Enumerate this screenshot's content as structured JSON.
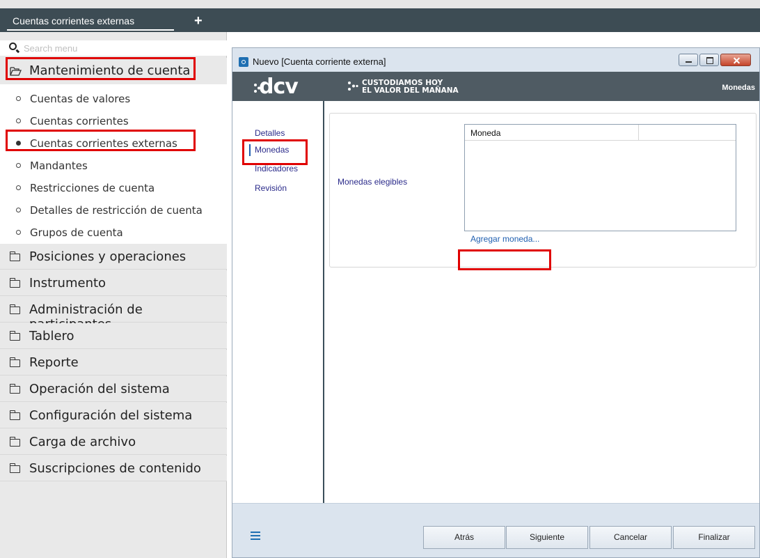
{
  "tabbar": {
    "active_tab": "Cuentas corrientes externas",
    "add_icon": "plus-icon"
  },
  "sidebar": {
    "search_placeholder": "Search menu",
    "open_section": "Mantenimiento de cuenta",
    "items": [
      {
        "label": "Cuentas de valores"
      },
      {
        "label": "Cuentas corrientes"
      },
      {
        "label": "Cuentas corrientes externas"
      },
      {
        "label": "Mandantes"
      },
      {
        "label": "Restricciones de cuenta"
      },
      {
        "label": "Detalles de restricción de cuenta"
      },
      {
        "label": "Grupos de cuenta"
      }
    ],
    "sections": [
      {
        "label": "Posiciones y operaciones"
      },
      {
        "label": "Instrumento"
      },
      {
        "label": "Administración de participantes"
      },
      {
        "label": "Tablero"
      },
      {
        "label": "Reporte"
      },
      {
        "label": "Operación del sistema"
      },
      {
        "label": "Configuración del sistema"
      },
      {
        "label": "Carga de archivo"
      },
      {
        "label": "Suscripciones de contenido"
      }
    ]
  },
  "dialog": {
    "title": "Nuevo [Cuenta corriente externa]",
    "banner": {
      "logo": "dcv",
      "tagline_1": "CUSTODIAMOS HOY",
      "tagline_2": "EL VALOR DEL MAÑANA",
      "step": "Monedas"
    },
    "nav": [
      {
        "label": "Detalles"
      },
      {
        "label": "Monedas"
      },
      {
        "label": "Indicadores"
      },
      {
        "label": "Revisión"
      }
    ],
    "form": {
      "field_label": "Monedas elegibles",
      "grid_header": "Moneda",
      "add_link": "Agregar moneda..."
    },
    "buttons": {
      "back": "Atrás",
      "next": "Siguiente",
      "cancel": "Cancelar",
      "finish": "Finalizar"
    }
  },
  "colors": {
    "tabbar": "#3d4c54",
    "banner": "#4f5b63",
    "highlight": "#e00000",
    "link": "#1f5fb0",
    "dialog_chrome": "#dbe4ee"
  }
}
